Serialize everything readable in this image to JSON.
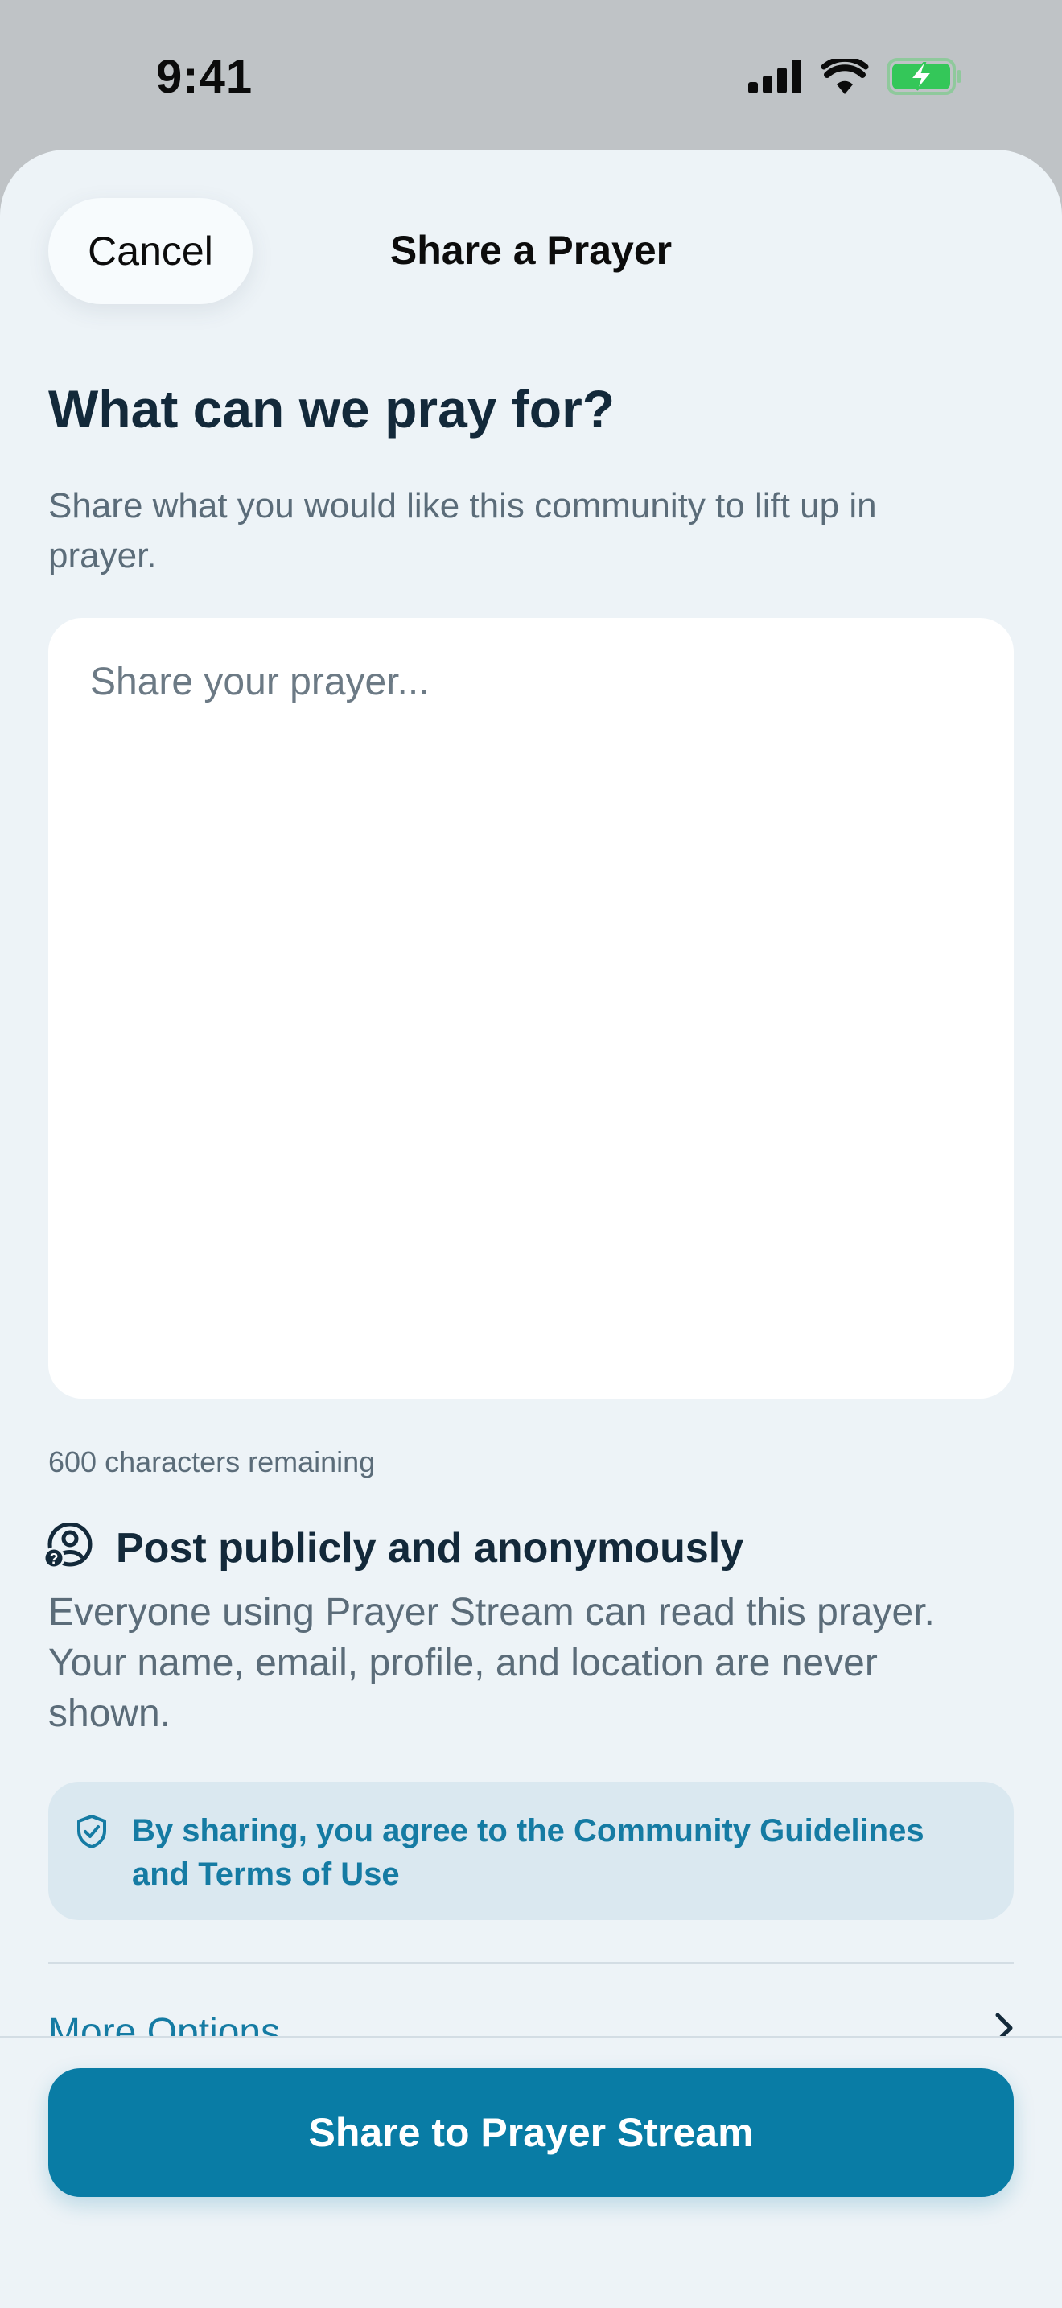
{
  "status_bar": {
    "time": "9:41",
    "icons": [
      "cellular-signal-icon",
      "wifi-icon",
      "battery-charging-icon"
    ],
    "battery_color": "#34c759"
  },
  "header": {
    "cancel_label": "Cancel",
    "title": "Share a Prayer"
  },
  "prompt": {
    "heading": "What can we pray for?",
    "subtitle": "Share what you would like this community to lift up in prayer."
  },
  "prayer_input": {
    "value": "",
    "placeholder": "Share your prayer..."
  },
  "char_count": "600 characters remaining",
  "visibility": {
    "icon": "anonymous-user-icon",
    "title": "Post publicly and anonymously",
    "description": "Everyone using Prayer Stream can read this prayer. Your name, email, profile, and location are never shown."
  },
  "guidelines": {
    "icon": "shield-check-icon",
    "text": "By sharing, you agree to the Community Guidelines and Terms of Use"
  },
  "more_options": {
    "label": "More Options",
    "icon": "chevron-right-icon"
  },
  "share_button_label": "Share to Prayer Stream",
  "colors": {
    "accent": "#097ca5",
    "link": "#157ba3",
    "background": "#edf3f7",
    "heading": "#13293a",
    "muted": "#5b6c79"
  }
}
